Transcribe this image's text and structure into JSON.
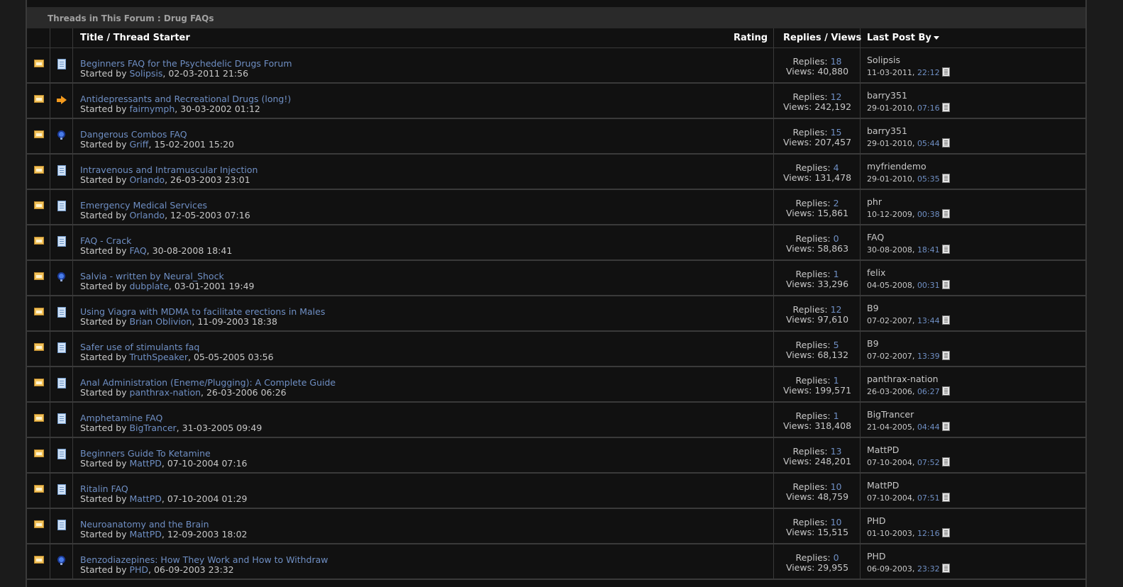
{
  "header": {
    "title": "Threads in This Forum : Drug FAQs"
  },
  "columns": {
    "title": "Title",
    "separator": "/",
    "starter": "Thread Starter",
    "rating": "Rating",
    "replies": "Replies",
    "views": "Views",
    "last_post": "Last Post By"
  },
  "labels": {
    "started_by": "Started by",
    "replies": "Replies:",
    "views": "Views:"
  },
  "threads": [
    {
      "icon": "document-icon",
      "title": "Beginners FAQ for the Psychedelic Drugs Forum",
      "starter": "Solipsis",
      "started": "02-03-2011 21:56",
      "replies": "18",
      "views": "40,880",
      "last_user": "Solipsis",
      "last_date": "11-03-2011,",
      "last_time": "22:12"
    },
    {
      "icon": "arrow-icon",
      "title": "Antidepressants and Recreational Drugs (long!)",
      "starter": "fairnymph",
      "started": "30-03-2002 01:12",
      "replies": "12",
      "views": "242,192",
      "last_user": "barry351",
      "last_date": "29-01-2010,",
      "last_time": "07:16"
    },
    {
      "icon": "lightbulb-icon",
      "title": "Dangerous Combos FAQ",
      "starter": "Griff",
      "started": "15-02-2001 15:20",
      "replies": "15",
      "views": "207,457",
      "last_user": "barry351",
      "last_date": "29-01-2010,",
      "last_time": "05:44"
    },
    {
      "icon": "document-icon",
      "title": "Intravenous and Intramuscular Injection",
      "starter": "Orlando",
      "started": "26-03-2003 23:01",
      "replies": "4",
      "views": "131,478",
      "last_user": "myfriendemo",
      "last_date": "29-01-2010,",
      "last_time": "05:35"
    },
    {
      "icon": "document-icon",
      "title": "Emergency Medical Services",
      "starter": "Orlando",
      "started": "12-05-2003 07:16",
      "replies": "2",
      "views": "15,861",
      "last_user": "phr",
      "last_date": "10-12-2009,",
      "last_time": "00:38"
    },
    {
      "icon": "document-icon",
      "title": "FAQ - Crack",
      "starter": "FAQ",
      "started": "30-08-2008 18:41",
      "replies": "0",
      "views": "58,863",
      "last_user": "FAQ",
      "last_date": "30-08-2008,",
      "last_time": "18:41"
    },
    {
      "icon": "lightbulb-icon",
      "title": "Salvia - written by Neural_Shock",
      "starter": "dubplate",
      "started": "03-01-2001 19:49",
      "replies": "1",
      "views": "33,296",
      "last_user": "felix",
      "last_date": "04-05-2008,",
      "last_time": "00:31"
    },
    {
      "icon": "document-icon",
      "title": "Using Viagra with MDMA to facilitate erections in Males",
      "starter": "Brian Oblivion",
      "started": "11-09-2003 18:38",
      "replies": "12",
      "views": "97,610",
      "last_user": "B9",
      "last_date": "07-02-2007,",
      "last_time": "13:44"
    },
    {
      "icon": "document-icon",
      "title": "Safer use of stimulants faq",
      "starter": "TruthSpeaker",
      "started": "05-05-2005 03:56",
      "replies": "5",
      "views": "68,132",
      "last_user": "B9",
      "last_date": "07-02-2007,",
      "last_time": "13:39"
    },
    {
      "icon": "document-icon",
      "title": "Anal Administration (Eneme/Plugging): A Complete Guide",
      "starter": "panthrax-nation",
      "started": "26-03-2006 06:26",
      "replies": "1",
      "views": "199,571",
      "last_user": "panthrax-nation",
      "last_date": "26-03-2006,",
      "last_time": "06:27"
    },
    {
      "icon": "document-icon",
      "title": "Amphetamine FAQ",
      "starter": "BigTrancer",
      "started": "31-03-2005 09:49",
      "replies": "1",
      "views": "318,408",
      "last_user": "BigTrancer",
      "last_date": "21-04-2005,",
      "last_time": "04:44"
    },
    {
      "icon": "document-icon",
      "title": "Beginners Guide To Ketamine",
      "starter": "MattPD",
      "started": "07-10-2004 07:16",
      "replies": "13",
      "views": "248,201",
      "last_user": "MattPD",
      "last_date": "07-10-2004,",
      "last_time": "07:52"
    },
    {
      "icon": "document-icon",
      "title": "Ritalin FAQ",
      "starter": "MattPD",
      "started": "07-10-2004 01:29",
      "replies": "10",
      "views": "48,759",
      "last_user": "MattPD",
      "last_date": "07-10-2004,",
      "last_time": "07:51"
    },
    {
      "icon": "document-icon",
      "title": "Neuroanatomy and the Brain",
      "starter": "MattPD",
      "started": "12-09-2003 18:02",
      "replies": "10",
      "views": "15,515",
      "last_user": "PHD",
      "last_date": "01-10-2003,",
      "last_time": "12:16"
    },
    {
      "icon": "lightbulb-icon",
      "title": "Benzodiazepines: How They Work and How to Withdraw",
      "starter": "PHD",
      "started": "06-09-2003 23:32",
      "replies": "0",
      "views": "29,955",
      "last_user": "PHD",
      "last_date": "06-09-2003,",
      "last_time": "23:32"
    }
  ]
}
